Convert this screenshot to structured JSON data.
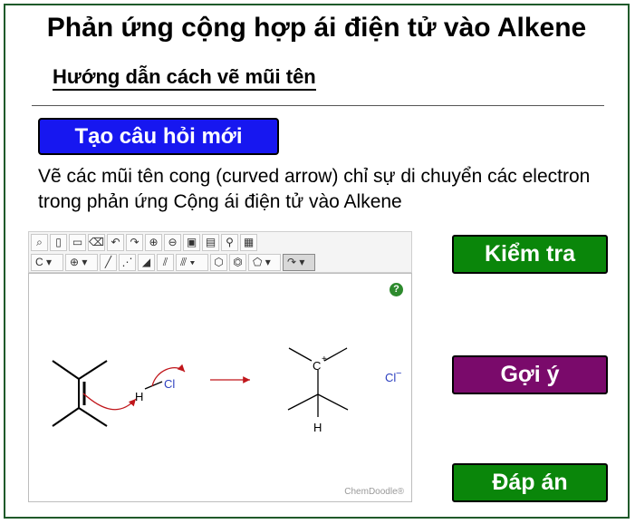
{
  "header": {
    "title": "Phản ứng cộng hợp ái điện tử vào Alkene",
    "subtitle": "Hướng dẫn cách vẽ mũi tên"
  },
  "new_question_button": "Tạo câu hỏi mới",
  "instructions": "Vẽ các mũi tên cong (curved arrow) chỉ sự di chuyển các electron trong phản ứng Cộng ái điện tử vào Alkene",
  "buttons": {
    "check": "Kiểm tra",
    "hint": "Gợi ý",
    "answer": "Đáp án"
  },
  "editor": {
    "atom_select": "C",
    "help_symbol": "?",
    "brand": "ChemDoodle®",
    "toolbar_icons": [
      "lasso-icon",
      "clear-icon",
      "eraser-icon",
      "clean-icon",
      "undo-icon",
      "redo-icon",
      "zoom-in-icon",
      "zoom-out-icon",
      "open-icon",
      "save-icon",
      "search-icon",
      "calculate-icon",
      "atom-select",
      "charge-icon",
      "single-bond-icon",
      "dashed-bond-icon",
      "wedge-bond-icon",
      "double-bond-icon",
      "triple-bond-icon",
      "hexagon-ring-icon",
      "benzene-ring-icon",
      "pentagon-ring-icon",
      "curved-arrow-icon"
    ],
    "molecule": {
      "h_label": "H",
      "cl_label": "Cl",
      "cation_label": "C",
      "cation_charge": "+",
      "h2_label": "H",
      "chloride_label": "Cl",
      "chloride_charge": "−"
    },
    "colors": {
      "arrow": "#c0161b",
      "chlorine": "#2b3fbf"
    }
  }
}
